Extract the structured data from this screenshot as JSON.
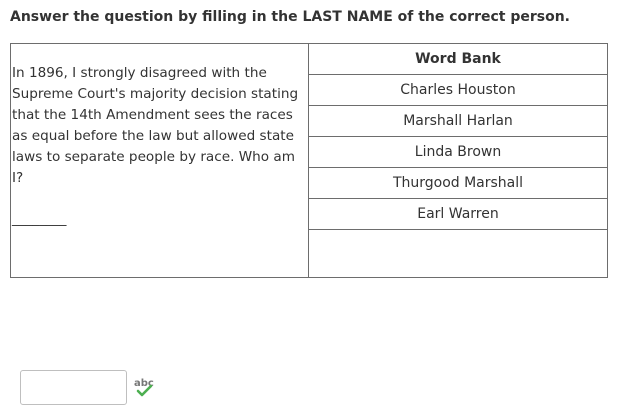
{
  "instruction": "Answer the question by filling in the LAST NAME of the correct person.",
  "question": {
    "text": "In 1896, I strongly disagreed with the Supreme Court's majority decision stating that the 14th Amendment sees the races as equal before the law but allowed state laws to separate people by race. Who am I?",
    "blank": "________"
  },
  "word_bank": {
    "header": "Word Bank",
    "items": [
      "Charles Houston",
      "Marshall Harlan",
      "Linda Brown",
      "Thurgood Marshall",
      "Earl Warren"
    ]
  },
  "answer": {
    "value": "",
    "placeholder": ""
  },
  "spellcheck": {
    "icon": "spellcheck-icon",
    "label": "abc",
    "check_color": "#4caf50",
    "text_color": "#777777"
  }
}
